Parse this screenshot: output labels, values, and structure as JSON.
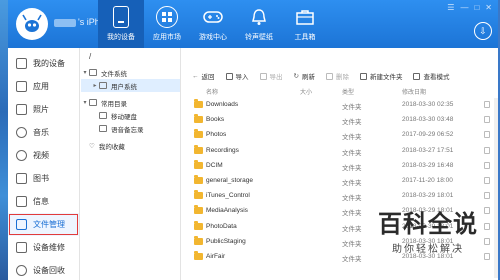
{
  "topbar": {
    "device_name": "'s iPho...",
    "tabs": [
      {
        "label": "我的设备",
        "icon": "phone-icon",
        "active": true
      },
      {
        "label": "应用市场",
        "icon": "appstore-icon",
        "active": false
      },
      {
        "label": "游戏中心",
        "icon": "gamepad-icon",
        "active": false
      },
      {
        "label": "铃声壁纸",
        "icon": "bell-icon",
        "active": false
      },
      {
        "label": "工具箱",
        "icon": "toolbox-icon",
        "active": false
      }
    ],
    "window_controls": [
      "☰",
      "—",
      "□",
      "✕"
    ]
  },
  "leftnav": {
    "items": [
      {
        "label": "我的设备",
        "icon": "device-icon"
      },
      {
        "label": "应用",
        "icon": "apps-icon"
      },
      {
        "label": "照片",
        "icon": "photo-icon"
      },
      {
        "label": "音乐",
        "icon": "music-icon"
      },
      {
        "label": "视频",
        "icon": "video-icon"
      },
      {
        "label": "图书",
        "icon": "book-icon"
      },
      {
        "label": "信息",
        "icon": "message-icon"
      },
      {
        "label": "文件管理",
        "icon": "folder-icon",
        "active": true
      },
      {
        "label": "设备维修",
        "icon": "repair-icon"
      },
      {
        "label": "设备回收",
        "icon": "recycle-icon"
      }
    ]
  },
  "tree": {
    "path": "/",
    "sections": [
      {
        "label": "文件系统",
        "expanded": true,
        "children": [
          {
            "label": "用户系统",
            "selected": true
          }
        ]
      },
      {
        "label": "常用目录",
        "expanded": true,
        "children": [
          {
            "label": "移动硬盘"
          },
          {
            "label": "语音备忘录"
          }
        ]
      },
      {
        "label": "我的收藏",
        "expanded": false,
        "children": []
      }
    ]
  },
  "toolbar": {
    "back": "返回",
    "import": "导入",
    "export": "导出",
    "refresh": "刷新",
    "delete": "删除",
    "new_folder": "新建文件夹",
    "view_mode": "查看模式"
  },
  "columns": {
    "name": "名称",
    "size": "大小",
    "type": "类型",
    "date": "修改日期"
  },
  "files": [
    {
      "name": "Downloads",
      "type": "文件夹",
      "date": "2018-03-30 02:35"
    },
    {
      "name": "Books",
      "type": "文件夹",
      "date": "2018-03-30 03:48"
    },
    {
      "name": "Photos",
      "type": "文件夹",
      "date": "2017-09-29 06:52"
    },
    {
      "name": "Recordings",
      "type": "文件夹",
      "date": "2018-03-27 17:51"
    },
    {
      "name": "DCIM",
      "type": "文件夹",
      "date": "2018-03-29 16:48"
    },
    {
      "name": "general_storage",
      "type": "文件夹",
      "date": "2017-11-20 18:00"
    },
    {
      "name": "iTunes_Control",
      "type": "文件夹",
      "date": "2018-03-29 18:01"
    },
    {
      "name": "MediaAnalysis",
      "type": "文件夹",
      "date": "2018-03-29 18:01"
    },
    {
      "name": "PhotoData",
      "type": "文件夹",
      "date": "2018-03-30 18:01"
    },
    {
      "name": "PublicStaging",
      "type": "文件夹",
      "date": "2018-03-30 18:01"
    },
    {
      "name": "AirFair",
      "type": "文件夹",
      "date": "2018-03-30 18:01"
    }
  ],
  "watermark": {
    "title": "百科全说",
    "subtitle": "助你轻松解决"
  }
}
